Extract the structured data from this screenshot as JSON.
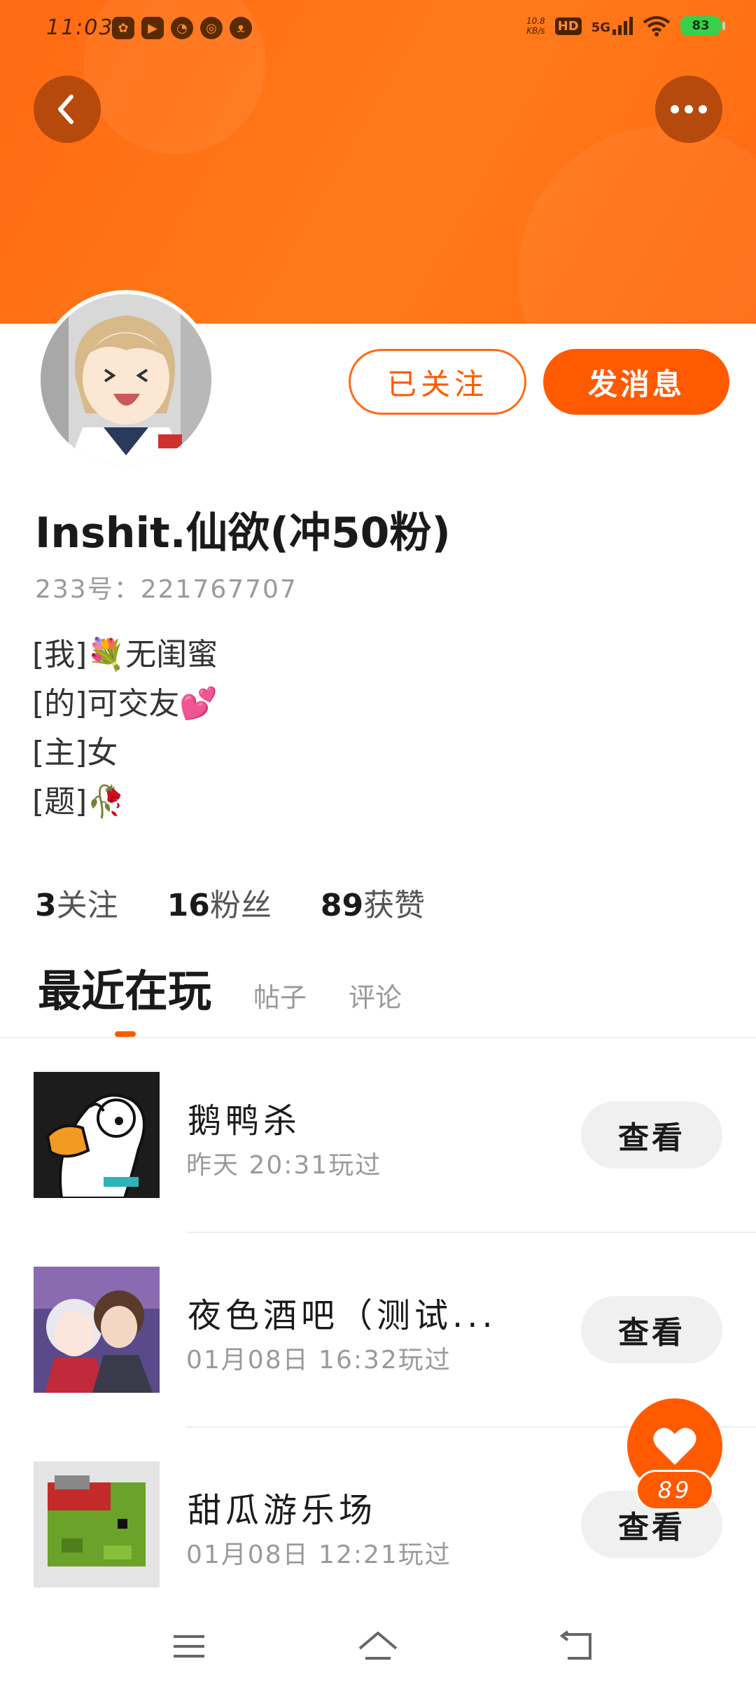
{
  "status_bar": {
    "time": "11:03",
    "net_speed_value": "10.8",
    "net_speed_unit": "KB/s",
    "hd_label": "HD",
    "network_label": "5G",
    "battery": "83"
  },
  "profile": {
    "username": "Inshit.仙欲(冲50粉)",
    "uid": "233号：221767707",
    "bio": [
      "[我]💐无闺蜜",
      "[的]可交友💕",
      "[主]女",
      "[题]🥀"
    ],
    "follow_button": "已关注",
    "message_button": "发消息"
  },
  "stats": {
    "following_count": "3",
    "following_label": "关注",
    "fans_count": "16",
    "fans_label": "粉丝",
    "likes_count": "89",
    "likes_label": "获赞"
  },
  "tabs": {
    "active": "最近在玩",
    "posts": "帖子",
    "comments": "评论"
  },
  "games": [
    {
      "name": "鹅鸭杀",
      "time": "昨天 20:31玩过",
      "button": "查看"
    },
    {
      "name": "夜色酒吧（测试...",
      "time": "01月08日 16:32玩过",
      "button": "查看"
    },
    {
      "name": "甜瓜游乐场",
      "time": "01月08日 12:21玩过",
      "button": "查看"
    }
  ],
  "like_fab": {
    "count": "89"
  },
  "colors": {
    "accent": "#ff5a00",
    "header": "#ff6a12"
  }
}
